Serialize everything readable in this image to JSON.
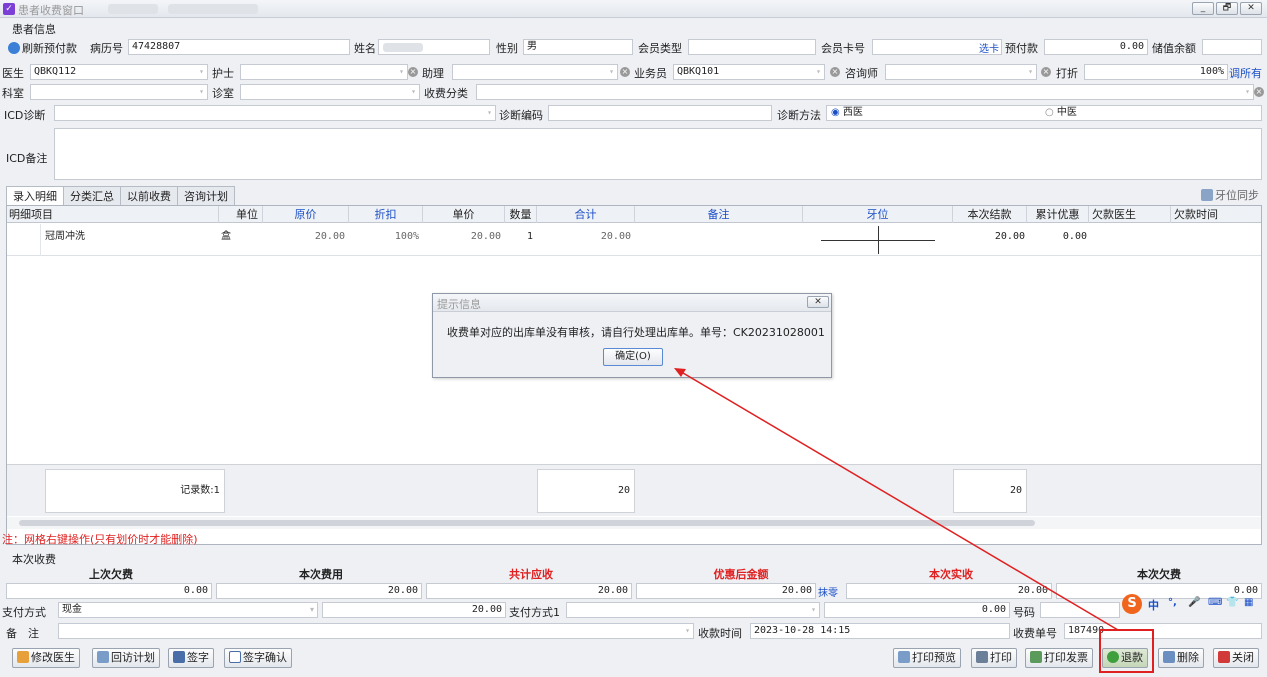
{
  "window": {
    "title": "患者收费窗口",
    "controls": [
      "_",
      "🗗",
      "✕"
    ]
  },
  "patient": {
    "group_label": "患者信息",
    "refresh_btn": "刷新预付款",
    "record_label": "病历号",
    "record_value": "47428807",
    "name_label": "姓名",
    "name_value": "",
    "gender_label": "性别",
    "gender_value": "男",
    "member_type_label": "会员类型",
    "member_type_value": "",
    "member_card_label": "会员卡号",
    "member_card_value": "",
    "select_card": "选卡",
    "prepay_label": "预付款",
    "prepay_value": "0.00",
    "stored_label": "储值余额",
    "stored_value": "",
    "doctor_label": "医生",
    "doctor_value": "QBKQ112",
    "nurse_label": "护士",
    "nurse_value": "",
    "assistant_label": "助理",
    "assistant_value": "",
    "salesman_label": "业务员",
    "salesman_value": "QBKQ101",
    "consultant_label": "咨询师",
    "consultant_value": "",
    "discount_label": "打折",
    "discount_value": "100%",
    "discount_all": "调所有",
    "dept_label": "科室",
    "dept_value": "",
    "room_label": "诊室",
    "room_value": "",
    "fee_class_label": "收费分类",
    "fee_class_value": "",
    "icd_label": "ICD诊断",
    "icd_value": "",
    "diag_code_label": "诊断编码",
    "diag_code_value": "",
    "diag_method_label": "诊断方法",
    "method_western": "西医",
    "method_chinese": "中医",
    "icd_note_label": "ICD备注",
    "icd_note_value": ""
  },
  "tabs": [
    "录入明细",
    "分类汇总",
    "以前收费",
    "咨询计划"
  ],
  "tooth_sync": "牙位同步",
  "grid": {
    "headers": [
      "明细项目",
      "单位",
      "原价",
      "折扣",
      "单价",
      "数量",
      "合计",
      "备注",
      "牙位",
      "本次结款",
      "累计优惠",
      "欠款医生",
      "欠款时间"
    ],
    "rows": [
      {
        "item": "冠周冲洗",
        "unit": "盒",
        "orig_price": "20.00",
        "discount": "100%",
        "unit_price": "20.00",
        "qty": "1",
        "total": "20.00",
        "note": "",
        "tooth": "",
        "settle": "20.00",
        "accum_discount": "0.00",
        "debt_doctor": "",
        "debt_time": ""
      }
    ],
    "footer": {
      "count": "记录数:1",
      "total": "20",
      "settle": "20"
    }
  },
  "grid_note": "注：网格右键操作(只有划价时才能删除)",
  "dialog": {
    "title": "提示信息",
    "message": "收费单对应的出库单没有审核，请自行处理出库单。单号：CK20231028001",
    "ok": "确定(O)"
  },
  "charge": {
    "group_label": "本次收费",
    "headers": [
      "上次欠费",
      "本次费用",
      "共计应收",
      "优惠后金额",
      "本次实收",
      "本次欠费"
    ],
    "values": [
      "0.00",
      "20.00",
      "20.00",
      "20.00",
      "20.00",
      "0.00"
    ],
    "erase": "抹零",
    "pay_method_label": "支付方式",
    "pay_method_value": "现金",
    "pay_amount": "20.00",
    "pay_method1_label": "支付方式1",
    "pay_method1_value": "",
    "pay_amount1": "0.00",
    "code_label": "号码",
    "code_value": "",
    "remark_label": "备　注",
    "remark_value": "",
    "time_label": "收款时间",
    "time_value": "2023-10-28 14:15",
    "receipt_label": "收费单号",
    "receipt_value": "187490"
  },
  "buttons_left": [
    "修改医生",
    "回访计划",
    "签字",
    "签字确认"
  ],
  "buttons_right": [
    "打印预览",
    "打印",
    "打印发票",
    "退款",
    "删除",
    "关闭"
  ],
  "ime": {
    "labels": [
      "中",
      "°,",
      "🎤",
      "⌨",
      "👕",
      "▦"
    ]
  },
  "colors": {
    "accent": "#1b4fc7",
    "warning": "#e02020",
    "annotation": "#e02020"
  }
}
